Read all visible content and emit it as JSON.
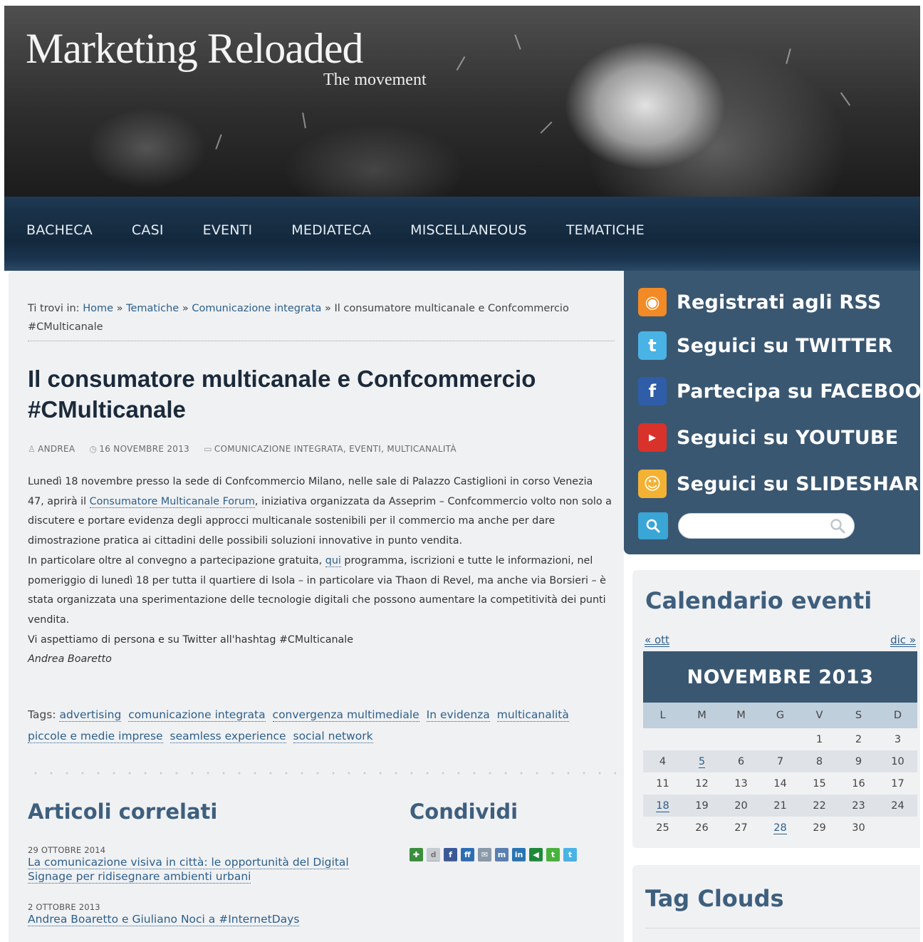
{
  "header": {
    "site_title": "Marketing Reloaded",
    "site_subtitle": "The movement"
  },
  "nav": {
    "items": [
      "BACHECA",
      "CASI",
      "EVENTI",
      "MEDIATECA",
      "MISCELLANEOUS",
      "TEMATICHE"
    ]
  },
  "breadcrumb": {
    "prefix": "Ti trovi in:",
    "home": "Home",
    "sep": "»",
    "level1": "Tematiche",
    "level2": "Comunicazione integrata",
    "current": "Il consumatore multicanale e Confcommercio #CMulticanale"
  },
  "post": {
    "title": "Il consumatore multicanale e Confcommercio #CMulticanale",
    "author": "ANDREA",
    "date": "16 NOVEMBRE 2013",
    "categories": "COMUNICAZIONE INTEGRATA, EVENTI, MULTICANALITÀ",
    "p1_a": "Lunedì 18 novembre presso la sede di Confcommercio Milano, nelle sale di Palazzo Castiglioni in corso Venezia 47, aprirà il ",
    "p1_link": "Consumatore Multicanale Forum",
    "p1_b": ", iniziativa organizzata da Asseprim – Confcommercio volto non solo a discutere e portare evidenza degli approcci multicanale sostenibili per il commercio ma anche per dare dimostrazione pratica ai cittadini delle possibili soluzioni innovative in punto vendita.",
    "p2_a": "In particolare oltre al convegno a partecipazione gratuita, ",
    "p2_link": "qui",
    "p2_b": " programma, iscrizioni e tutte le informazioni, nel pomeriggio di lunedì 18 per tutta il quartiere di Isola – in particolare via Thaon di Revel, ma anche via Borsieri – è stata organizzata una sperimentazione delle tecnologie digitali che possono aumentare la competitività dei punti vendita.",
    "p3": "Vi aspettiamo di persona e su Twitter all'hashtag #CMulticanale",
    "signature": "Andrea Boaretto"
  },
  "tags": {
    "label": "Tags:",
    "items": [
      "advertising",
      "comunicazione integrata",
      "convergenza multimediale",
      "In evidenza",
      "multicanalità",
      "piccole e medie imprese",
      "seamless experience",
      "social network"
    ]
  },
  "related": {
    "heading": "Articoli correlati",
    "items": [
      {
        "date": "29 OTTOBRE 2014",
        "title": "La comunicazione visiva in città: le opportunità del Digital Signage per ridisegnare ambienti urbani"
      },
      {
        "date": "2 OTTOBRE 2013",
        "title": "Andrea Boaretto e Giuliano Noci a #InternetDays"
      }
    ]
  },
  "share": {
    "heading": "Condividi",
    "icons": [
      "delicious-icon",
      "digg-icon",
      "facebook-icon",
      "friendfeed-icon",
      "email-icon",
      "myspace-icon",
      "linkedin-icon",
      "netvibes-icon",
      "technorati-icon",
      "twitter-icon"
    ]
  },
  "social": {
    "items": [
      {
        "label": "Registrati agli RSS",
        "icon": "rss-icon",
        "color": "#f28a25"
      },
      {
        "label": "Seguici su TWITTER",
        "icon": "twitter-icon",
        "color": "#4ab3e6"
      },
      {
        "label": "Partecipa su FACEBOOK",
        "icon": "facebook-icon",
        "color": "#2f5da8"
      },
      {
        "label": "Seguici su YOUTUBE",
        "icon": "youtube-icon",
        "color": "#d8322b"
      },
      {
        "label": "Seguici su SLIDESHARE",
        "icon": "slideshare-icon",
        "color": "#f3b234"
      }
    ],
    "search_placeholder": ""
  },
  "calendar": {
    "title": "Calendario eventi",
    "prev": "« ott",
    "next": "dic »",
    "month": "NOVEMBRE 2013",
    "weekdays": [
      "L",
      "M",
      "M",
      "G",
      "V",
      "S",
      "D"
    ],
    "weeks": [
      [
        "",
        "",
        "",
        "",
        "1",
        "2",
        "3"
      ],
      [
        "4",
        "5",
        "6",
        "7",
        "8",
        "9",
        "10"
      ],
      [
        "11",
        "12",
        "13",
        "14",
        "15",
        "16",
        "17"
      ],
      [
        "18",
        "19",
        "20",
        "21",
        "22",
        "23",
        "24"
      ],
      [
        "25",
        "26",
        "27",
        "28",
        "29",
        "30",
        ""
      ]
    ],
    "linked_days": [
      "5",
      "18",
      "28"
    ]
  },
  "tag_cloud": {
    "title": "Tag Clouds"
  },
  "colors": {
    "nav_bg": "#13283c",
    "panel_bg": "#3a5771",
    "link": "#2c5f8a",
    "heading": "#3e5f7e"
  }
}
